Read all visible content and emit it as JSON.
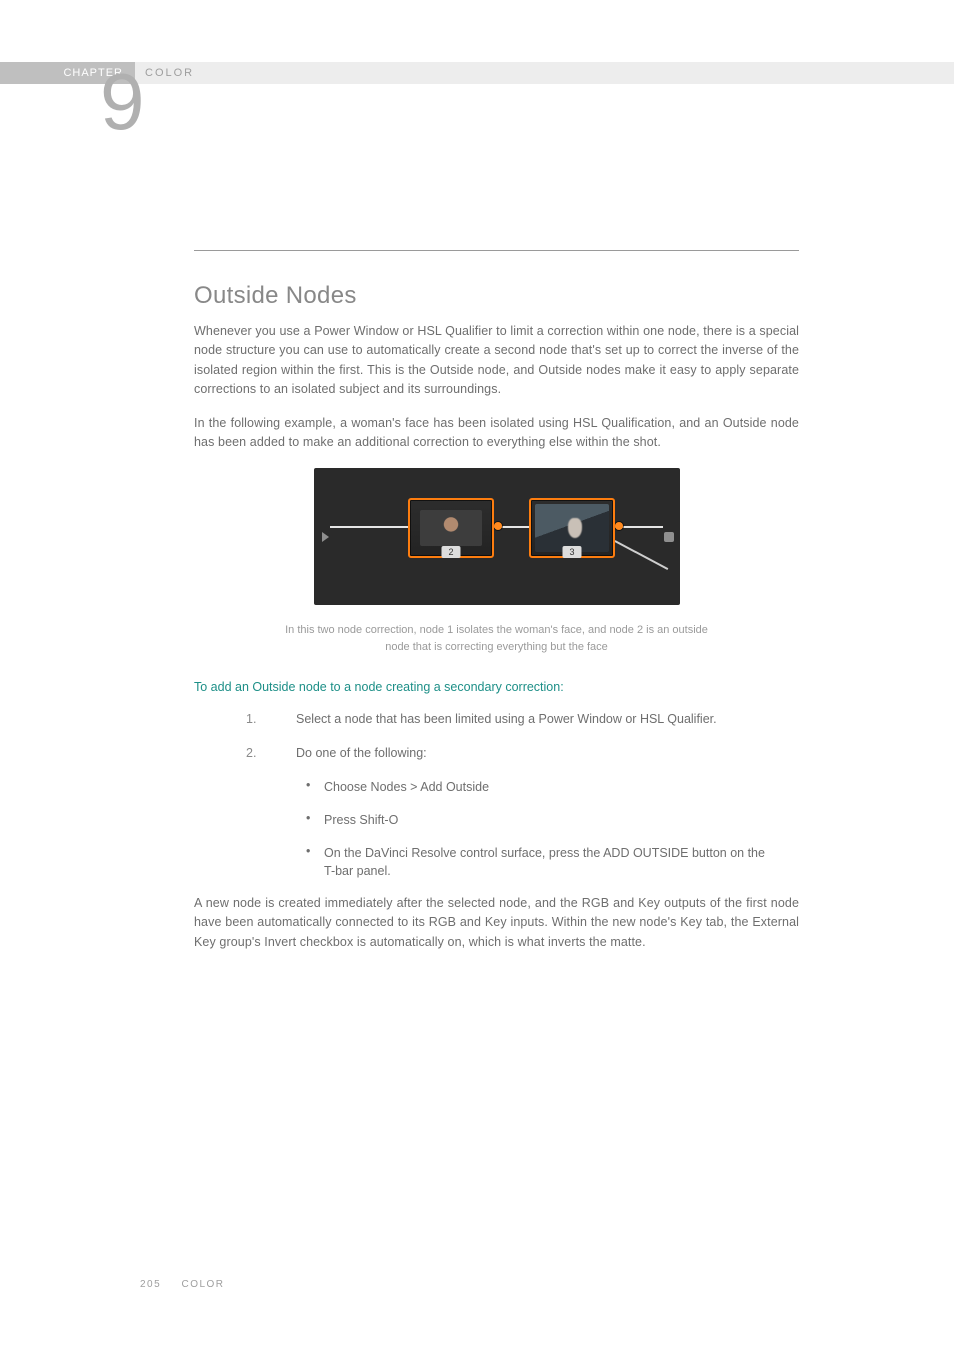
{
  "header": {
    "chapter_label": "CHAPTER",
    "section_label": "COLOR",
    "chapter_number": "9"
  },
  "title": "Outside Nodes",
  "paragraphs": {
    "p1": "Whenever you use a Power Window or HSL Qualifier to limit a correction within one node, there is a special node structure you can use to automatically create a second node that's set up to correct the inverse of the isolated region within the first. This is the Outside node, and Outside nodes make it easy to apply separate corrections to an isolated subject and its surroundings.",
    "p2": "In the following example, a woman's face has been isolated using HSL Qualification, and an Outside node has been added to make an additional correction to everything else within the shot.",
    "p3": "A new node is created immediately after the selected node, and the RGB and Key outputs of the first node have been automatically connected to its RGB and Key inputs. Within the new node's Key tab, the External Key group's Invert checkbox is automatically on, which is what inverts the matte."
  },
  "figure": {
    "node_labels": {
      "n1": "2",
      "n2": "3"
    },
    "caption_l1": "In this two node correction, node 1 isolates the woman's face, and node 2 is an outside",
    "caption_l2": "node that is correcting everything but the face"
  },
  "subhead": "To add an Outside node to a node creating a secondary correction:",
  "steps": {
    "s1_num": "1.",
    "s1_txt": "Select a node that has been limited using a Power Window or HSL Qualifier.",
    "s2_num": "2.",
    "s2_txt": "Do one of the following:",
    "b1": "Choose Nodes > Add Outside",
    "b2": "Press Shift-O",
    "b3": "On the DaVinci Resolve control surface, press the ADD OUTSIDE button on the T-bar panel."
  },
  "footer": {
    "page_number": "205",
    "section": "COLOR"
  }
}
